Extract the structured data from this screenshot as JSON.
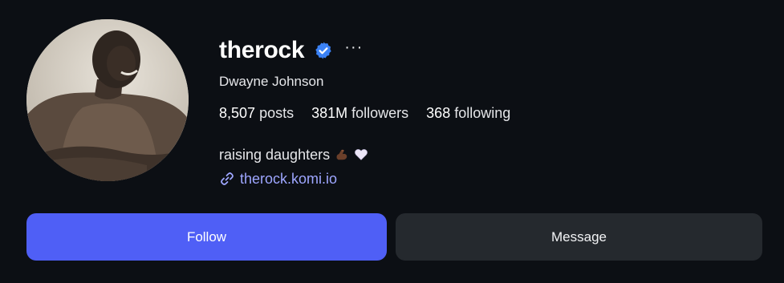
{
  "profile": {
    "username": "therock",
    "full_name": "Dwayne Johnson",
    "more_label": "···",
    "avatar_icon": "profile-photo",
    "verified_icon": "verified-badge-icon",
    "stats": {
      "posts_count": "8,507",
      "posts_label": "posts",
      "followers_count": "381M",
      "followers_label": "followers",
      "following_count": "368",
      "following_label": "following"
    },
    "bio_text": "raising daughters",
    "bio_emojis": [
      "flexed-biceps-emoji",
      "white-heart-emoji"
    ],
    "link_icon": "link-icon",
    "link_text": "therock.komi.io"
  },
  "actions": {
    "follow_label": "Follow",
    "message_label": "Message"
  },
  "colors": {
    "background": "#0c0f14",
    "follow_button": "#4f5ff6",
    "message_button": "#25292e",
    "link": "#9ea6ff",
    "verified": "#3b82f6"
  }
}
